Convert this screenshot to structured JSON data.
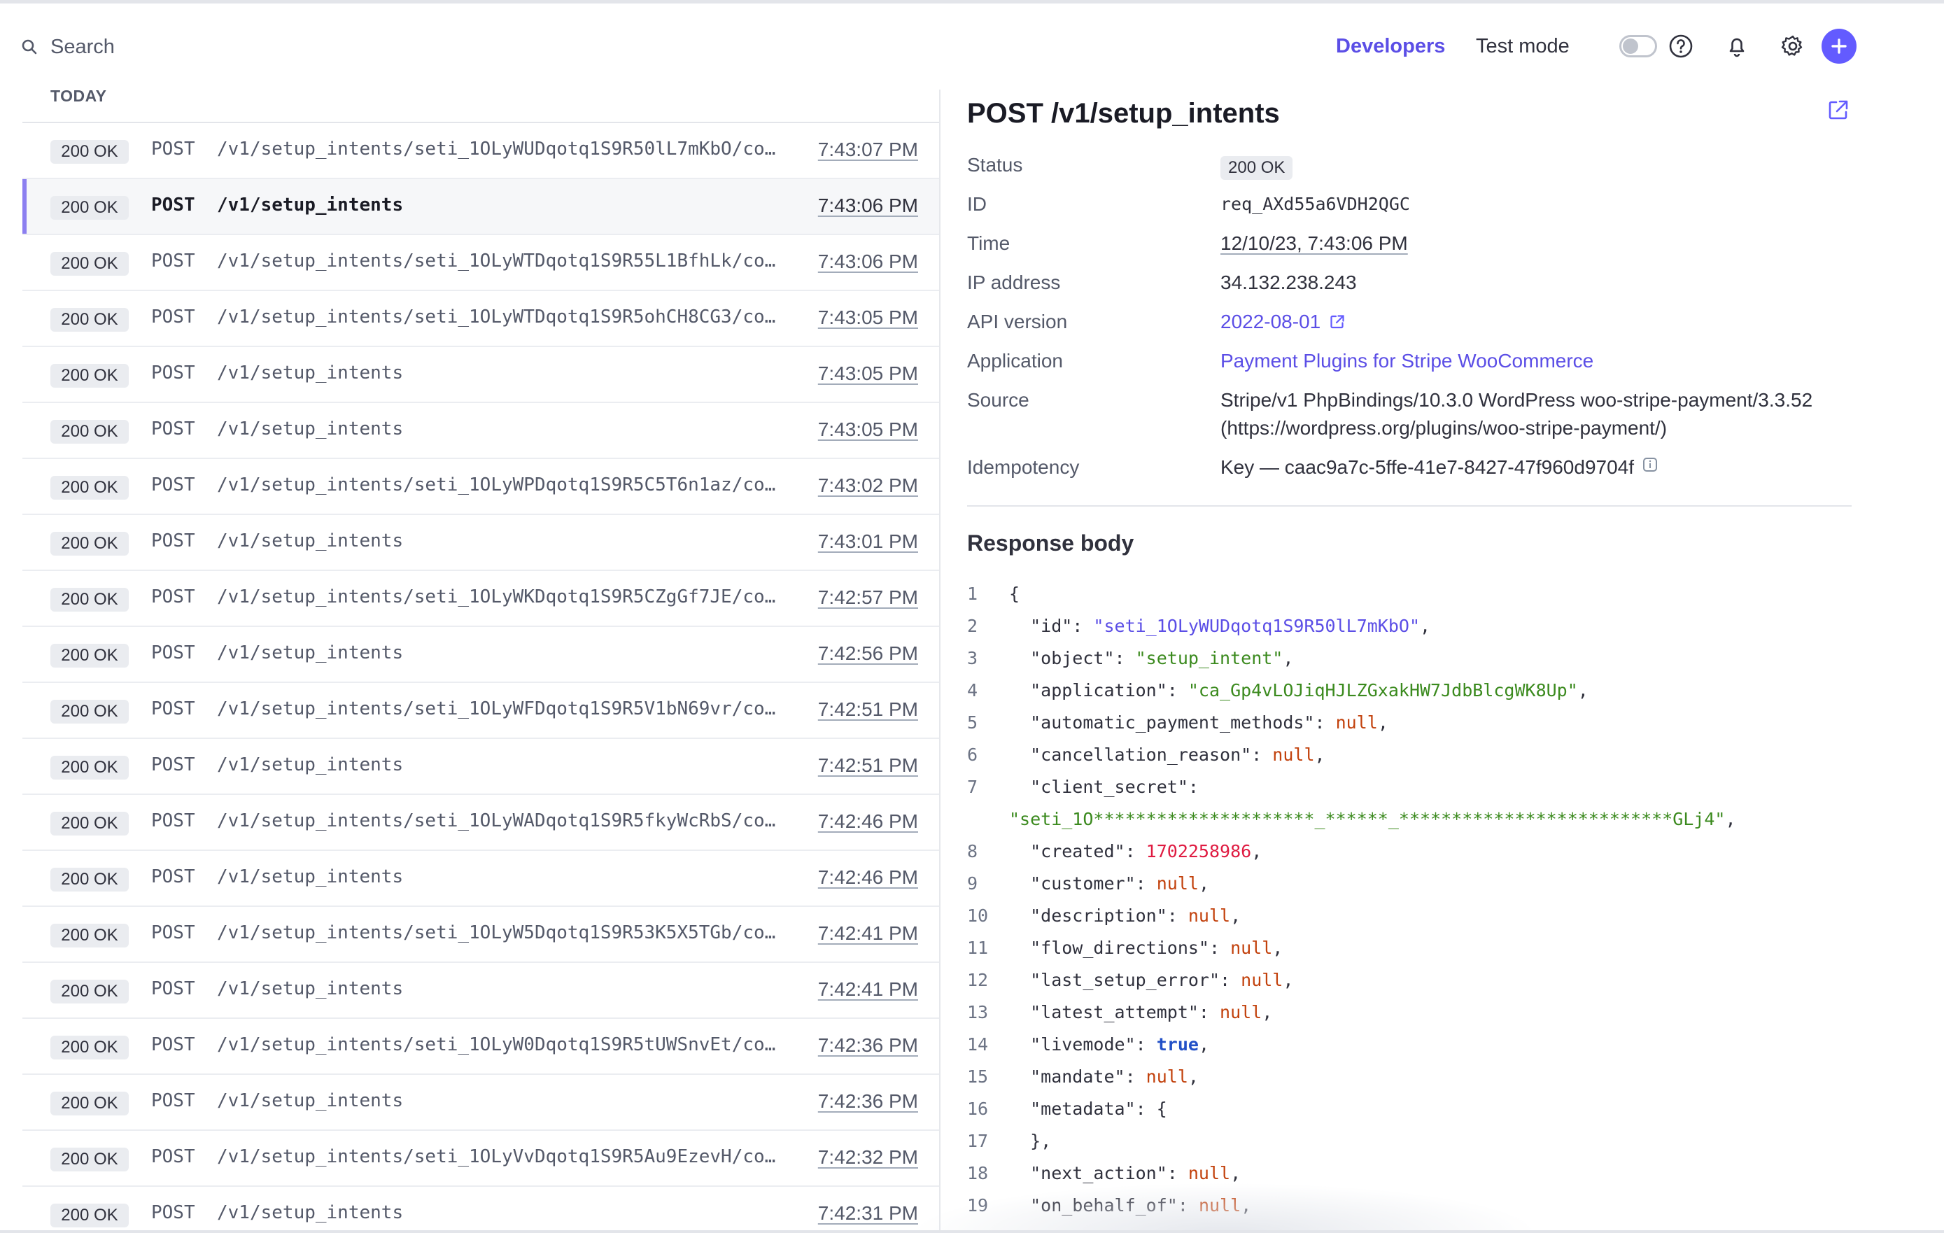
{
  "header": {
    "search_placeholder": "Search",
    "developers_label": "Developers",
    "test_mode_label": "Test mode",
    "test_mode_on": false,
    "accent_color": "#635bff"
  },
  "list": {
    "section_label": "TODAY",
    "rows": [
      {
        "status": "200 OK",
        "method": "POST",
        "path": "/v1/setup_intents/seti_1OLyWUDqotq1S9R50lL7mKbO/co…",
        "time": "7:43:07 PM"
      },
      {
        "status": "200 OK",
        "method": "POST",
        "path": "/v1/setup_intents",
        "time": "7:43:06 PM",
        "selected": true
      },
      {
        "status": "200 OK",
        "method": "POST",
        "path": "/v1/setup_intents/seti_1OLyWTDqotq1S9R55L1BfhLk/co…",
        "time": "7:43:06 PM"
      },
      {
        "status": "200 OK",
        "method": "POST",
        "path": "/v1/setup_intents/seti_1OLyWTDqotq1S9R5ohCH8CG3/co…",
        "time": "7:43:05 PM"
      },
      {
        "status": "200 OK",
        "method": "POST",
        "path": "/v1/setup_intents",
        "time": "7:43:05 PM"
      },
      {
        "status": "200 OK",
        "method": "POST",
        "path": "/v1/setup_intents",
        "time": "7:43:05 PM"
      },
      {
        "status": "200 OK",
        "method": "POST",
        "path": "/v1/setup_intents/seti_1OLyWPDqotq1S9R5C5T6n1az/co…",
        "time": "7:43:02 PM"
      },
      {
        "status": "200 OK",
        "method": "POST",
        "path": "/v1/setup_intents",
        "time": "7:43:01 PM"
      },
      {
        "status": "200 OK",
        "method": "POST",
        "path": "/v1/setup_intents/seti_1OLyWKDqotq1S9R5CZgGf7JE/co…",
        "time": "7:42:57 PM"
      },
      {
        "status": "200 OK",
        "method": "POST",
        "path": "/v1/setup_intents",
        "time": "7:42:56 PM"
      },
      {
        "status": "200 OK",
        "method": "POST",
        "path": "/v1/setup_intents/seti_1OLyWFDqotq1S9R5V1bN69vr/co…",
        "time": "7:42:51 PM"
      },
      {
        "status": "200 OK",
        "method": "POST",
        "path": "/v1/setup_intents",
        "time": "7:42:51 PM"
      },
      {
        "status": "200 OK",
        "method": "POST",
        "path": "/v1/setup_intents/seti_1OLyWADqotq1S9R5fkyWcRbS/co…",
        "time": "7:42:46 PM"
      },
      {
        "status": "200 OK",
        "method": "POST",
        "path": "/v1/setup_intents",
        "time": "7:42:46 PM"
      },
      {
        "status": "200 OK",
        "method": "POST",
        "path": "/v1/setup_intents/seti_1OLyW5Dqotq1S9R53K5X5TGb/co…",
        "time": "7:42:41 PM"
      },
      {
        "status": "200 OK",
        "method": "POST",
        "path": "/v1/setup_intents",
        "time": "7:42:41 PM"
      },
      {
        "status": "200 OK",
        "method": "POST",
        "path": "/v1/setup_intents/seti_1OLyW0Dqotq1S9R5tUWSnvEt/co…",
        "time": "7:42:36 PM"
      },
      {
        "status": "200 OK",
        "method": "POST",
        "path": "/v1/setup_intents",
        "time": "7:42:36 PM"
      },
      {
        "status": "200 OK",
        "method": "POST",
        "path": "/v1/setup_intents/seti_1OLyVvDqotq1S9R5Au9EzevH/co…",
        "time": "7:42:32 PM"
      },
      {
        "status": "200 OK",
        "method": "POST",
        "path": "/v1/setup_intents",
        "time": "7:42:31 PM"
      }
    ]
  },
  "detail": {
    "title": "POST /v1/setup_intents",
    "fields": {
      "status": {
        "label": "Status",
        "value": "200 OK"
      },
      "id": {
        "label": "ID",
        "value": "req_AXd55a6VDH2QGC"
      },
      "time": {
        "label": "Time",
        "value": "12/10/23, 7:43:06 PM"
      },
      "ip": {
        "label": "IP address",
        "value": "34.132.238.243"
      },
      "api_version": {
        "label": "API version",
        "value": "2022-08-01"
      },
      "application": {
        "label": "Application",
        "value": "Payment Plugins for Stripe WooCommerce"
      },
      "source": {
        "label": "Source",
        "value": "Stripe/v1 PhpBindings/10.3.0 WordPress woo-stripe-payment/3.3.52 (https://wordpress.org/plugins/woo-stripe-payment/)"
      },
      "idempotency": {
        "label": "Idempotency",
        "value": "Key — caac9a7c-5ffe-41e7-8427-47f960d9704f"
      }
    },
    "response_title": "Response body",
    "code_lines": [
      {
        "n": "1",
        "parts": [
          {
            "t": "{",
            "c": ""
          }
        ]
      },
      {
        "n": "2",
        "parts": [
          {
            "t": "  \"id\": ",
            "c": ""
          },
          {
            "t": "\"seti_1OLyWUDqotq1S9R50lL7mKbO\"",
            "c": "sb"
          },
          {
            "t": ",",
            "c": ""
          }
        ]
      },
      {
        "n": "3",
        "parts": [
          {
            "t": "  \"object\": ",
            "c": ""
          },
          {
            "t": "\"setup_intent\"",
            "c": "s"
          },
          {
            "t": ",",
            "c": ""
          }
        ]
      },
      {
        "n": "4",
        "parts": [
          {
            "t": "  \"application\": ",
            "c": ""
          },
          {
            "t": "\"ca_Gp4vLOJiqHJLZGxakHW7JdbBlcgWK8Up\"",
            "c": "s"
          },
          {
            "t": ",",
            "c": ""
          }
        ]
      },
      {
        "n": "5",
        "parts": [
          {
            "t": "  \"automatic_payment_methods\": ",
            "c": ""
          },
          {
            "t": "null",
            "c": "nl"
          },
          {
            "t": ",",
            "c": ""
          }
        ]
      },
      {
        "n": "6",
        "parts": [
          {
            "t": "  \"cancellation_reason\": ",
            "c": ""
          },
          {
            "t": "null",
            "c": "nl"
          },
          {
            "t": ",",
            "c": ""
          }
        ]
      },
      {
        "n": "7",
        "parts": [
          {
            "t": "  \"client_secret\":",
            "c": ""
          }
        ]
      },
      {
        "n": "",
        "parts": [
          {
            "t": "\"seti_1O*********************_******_**************************GLj4\"",
            "c": "s"
          },
          {
            "t": ",",
            "c": ""
          }
        ],
        "wrap": true
      },
      {
        "n": "8",
        "parts": [
          {
            "t": "  \"created\": ",
            "c": ""
          },
          {
            "t": "1702258986",
            "c": "num"
          },
          {
            "t": ",",
            "c": ""
          }
        ]
      },
      {
        "n": "9",
        "parts": [
          {
            "t": "  \"customer\": ",
            "c": ""
          },
          {
            "t": "null",
            "c": "nl"
          },
          {
            "t": ",",
            "c": ""
          }
        ]
      },
      {
        "n": "10",
        "parts": [
          {
            "t": "  \"description\": ",
            "c": ""
          },
          {
            "t": "null",
            "c": "nl"
          },
          {
            "t": ",",
            "c": ""
          }
        ]
      },
      {
        "n": "11",
        "parts": [
          {
            "t": "  \"flow_directions\": ",
            "c": ""
          },
          {
            "t": "null",
            "c": "nl"
          },
          {
            "t": ",",
            "c": ""
          }
        ]
      },
      {
        "n": "12",
        "parts": [
          {
            "t": "  \"last_setup_error\": ",
            "c": ""
          },
          {
            "t": "null",
            "c": "nl"
          },
          {
            "t": ",",
            "c": ""
          }
        ]
      },
      {
        "n": "13",
        "parts": [
          {
            "t": "  \"latest_attempt\": ",
            "c": ""
          },
          {
            "t": "null",
            "c": "nl"
          },
          {
            "t": ",",
            "c": ""
          }
        ]
      },
      {
        "n": "14",
        "parts": [
          {
            "t": "  \"livemode\": ",
            "c": ""
          },
          {
            "t": "true",
            "c": "bool"
          },
          {
            "t": ",",
            "c": ""
          }
        ]
      },
      {
        "n": "15",
        "parts": [
          {
            "t": "  \"mandate\": ",
            "c": ""
          },
          {
            "t": "null",
            "c": "nl"
          },
          {
            "t": ",",
            "c": ""
          }
        ]
      },
      {
        "n": "16",
        "parts": [
          {
            "t": "  \"metadata\": {",
            "c": ""
          }
        ]
      },
      {
        "n": "17",
        "parts": [
          {
            "t": "  },",
            "c": ""
          }
        ]
      },
      {
        "n": "18",
        "parts": [
          {
            "t": "  \"next_action\": ",
            "c": ""
          },
          {
            "t": "null",
            "c": "nl"
          },
          {
            "t": ",",
            "c": ""
          }
        ]
      },
      {
        "n": "19",
        "parts": [
          {
            "t": "  \"on_behalf_of\": ",
            "c": ""
          },
          {
            "t": "null",
            "c": "nl"
          },
          {
            "t": ",",
            "c": ""
          }
        ]
      }
    ]
  }
}
